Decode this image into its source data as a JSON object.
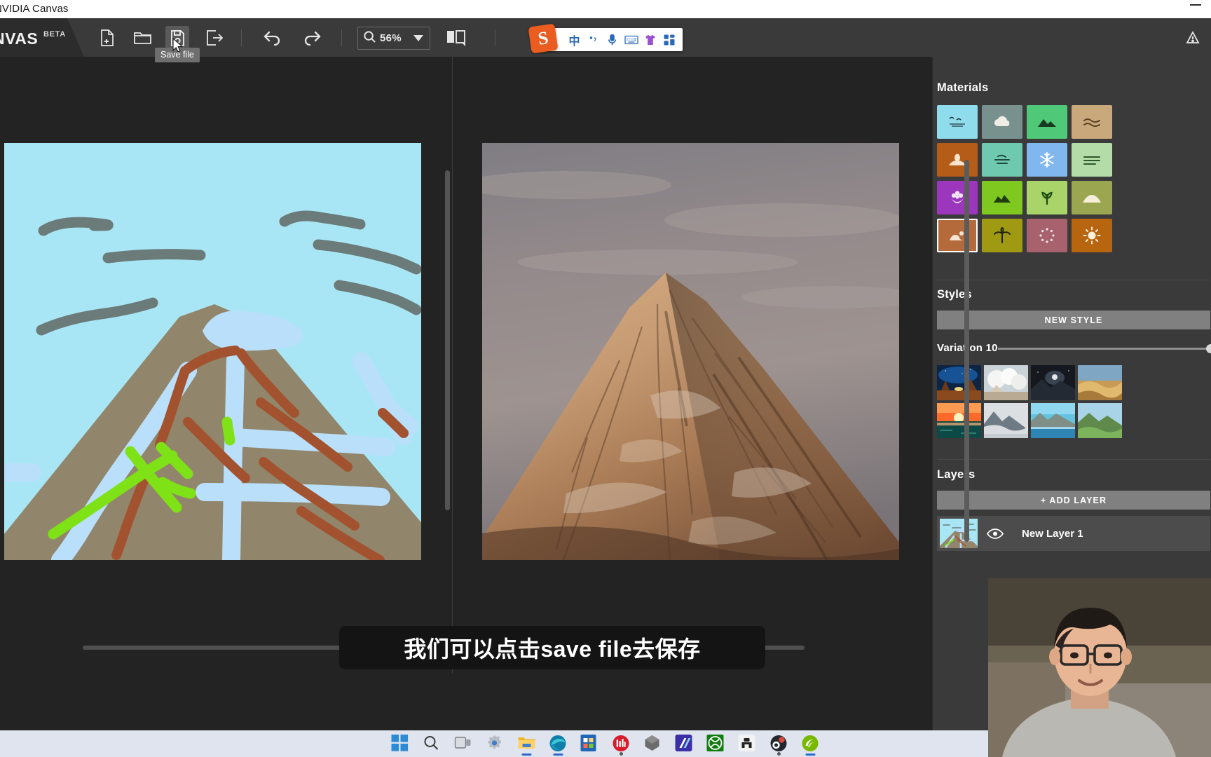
{
  "window": {
    "title": "NVIDIA Canvas",
    "minimize_icon": "minimize-icon"
  },
  "brand": {
    "name": "NVAS",
    "beta": "BETA"
  },
  "toolbar": {
    "new_file": "new-file-icon",
    "open_file": "open-folder-icon",
    "save_file": "save-file-icon",
    "export_file": "export-icon",
    "undo": "undo-icon",
    "redo": "redo-icon",
    "zoom_icon": "search-icon",
    "zoom_level": "56%",
    "zoom_caret": "chevron-down-icon",
    "compare_view": "compare-panels-icon",
    "tooltip": "Save file",
    "cursor": "mouse-cursor-icon"
  },
  "ime": {
    "logo": "sogou-logo",
    "logo_char": "S",
    "mode": "中",
    "punctuation_icon": "punctuation-icon",
    "mic_icon": "microphone-icon",
    "keyboard_icon": "keyboard-icon",
    "skin_icon": "tshirt-skin-icon",
    "apps_icon": "apps-grid-icon"
  },
  "panel": {
    "materials_title": "Materials",
    "styles_title": "Styles",
    "new_style_label": "NEW STYLE",
    "variation_label": "Variation 10",
    "layers_title": "Layers",
    "add_layer_label": "+ ADD LAYER",
    "layer_name": "New Layer 1",
    "layer_visibility_icon": "eye-icon"
  },
  "materials": [
    {
      "name": "sky",
      "color": "#8fdced",
      "icon": "birds-sky-icon",
      "selected": false
    },
    {
      "name": "cloud",
      "color": "#78918f",
      "icon": "cloud-icon",
      "selected": false
    },
    {
      "name": "mountain",
      "color": "#4fc978",
      "icon": "mountain-icon",
      "selected": false
    },
    {
      "name": "sand",
      "color": "#c9a97b",
      "icon": "sand-icon",
      "selected": false
    },
    {
      "name": "dirt",
      "color": "#b45c18",
      "icon": "dirt-mound-icon",
      "selected": false
    },
    {
      "name": "fog",
      "color": "#6fc9ae",
      "icon": "fog-icon",
      "selected": false
    },
    {
      "name": "snow",
      "color": "#7fb7ee",
      "icon": "snowflake-icon",
      "selected": false
    },
    {
      "name": "grass-pale",
      "color": "#b4dca8",
      "icon": "grass-lines-icon",
      "selected": false
    },
    {
      "name": "flower",
      "color": "#9b36bd",
      "icon": "flower-icon",
      "selected": false
    },
    {
      "name": "bush",
      "color": "#7ec81f",
      "icon": "bush-icon",
      "selected": false
    },
    {
      "name": "grass",
      "color": "#a8d46a",
      "icon": "grass-icon",
      "selected": false
    },
    {
      "name": "hill",
      "color": "#9aa650",
      "icon": "hill-icon",
      "selected": false
    },
    {
      "name": "rock",
      "color": "#b56a3c",
      "icon": "rock-icon",
      "selected": true
    },
    {
      "name": "tree",
      "color": "#a09a12",
      "icon": "palm-tree-icon",
      "selected": false
    },
    {
      "name": "river",
      "color": "#a8626e",
      "icon": "dots-ring-icon",
      "selected": false
    },
    {
      "name": "sun",
      "color": "#b8650f",
      "icon": "sun-icon",
      "selected": false
    }
  ],
  "variations": [
    {
      "name": "variation-1",
      "desc": "desert-night"
    },
    {
      "name": "variation-2",
      "desc": "white-cloudy-peaks"
    },
    {
      "name": "variation-3",
      "desc": "dark-starry-mountain"
    },
    {
      "name": "variation-4",
      "desc": "golden-dunes"
    },
    {
      "name": "variation-5",
      "desc": "ocean-sunset"
    },
    {
      "name": "variation-6",
      "desc": "foggy-snow-peak"
    },
    {
      "name": "variation-7",
      "desc": "blue-lake-mountain"
    },
    {
      "name": "variation-8",
      "desc": "green-valley"
    }
  ],
  "sketch": {
    "title": "hand-drawn-mountain-sketch",
    "sky_color": "#a9e6f5",
    "mountain_color": "#91866b",
    "cloud_color": "#6b7b79",
    "snow_color": "#b9dffb",
    "rock_color": "#a3522f",
    "grass_color": "#7ee216"
  },
  "render": {
    "title": "ai-generated-mountain-peak"
  },
  "subtitle": {
    "text": "我们可以点击save file去保存"
  },
  "taskbar": {
    "items": [
      {
        "name": "start-button",
        "icon": "windows-logo-icon",
        "running": false
      },
      {
        "name": "search-button",
        "icon": "search-icon",
        "running": false
      },
      {
        "name": "task-view-button",
        "icon": "task-view-icon",
        "running": false
      },
      {
        "name": "settings-button",
        "icon": "gear-icon",
        "running": false
      },
      {
        "name": "file-explorer-button",
        "icon": "folder-icon",
        "running": true
      },
      {
        "name": "edge-button",
        "icon": "edge-icon",
        "running": true
      },
      {
        "name": "microsoft-store-button",
        "icon": "store-icon",
        "running": false
      },
      {
        "name": "wondershare-button",
        "icon": "red-circle-icon",
        "running": true
      },
      {
        "name": "substance-button",
        "icon": "diamond-icon",
        "running": false
      },
      {
        "name": "affinity-button",
        "icon": "affinity-icon",
        "running": false
      },
      {
        "name": "xbox-button",
        "icon": "xbox-icon",
        "running": false
      },
      {
        "name": "capture-button",
        "icon": "capture-icon",
        "running": false
      },
      {
        "name": "obs-button",
        "icon": "obs-icon",
        "running": true
      },
      {
        "name": "nvidia-canvas-button",
        "icon": "canvas-icon",
        "running": true
      }
    ],
    "tray": {
      "volume_icon": "volume-icon",
      "network_icon": "network-icon"
    }
  },
  "colors": {
    "toolbar_bg": "#3a3a3a",
    "panel_bg": "#3a3a3a",
    "workspace_bg": "#232323",
    "accent": "#808080",
    "taskbar_bg": "#dfe4ee"
  }
}
